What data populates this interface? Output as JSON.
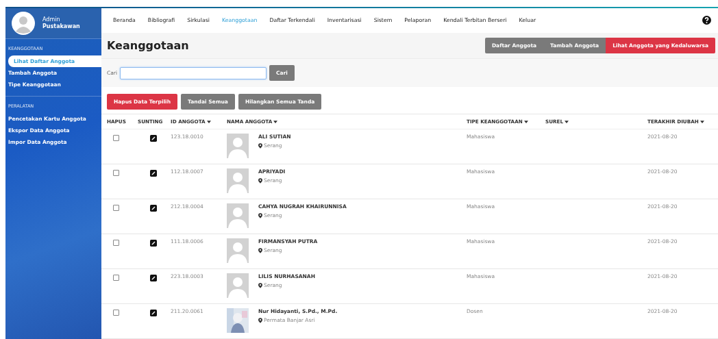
{
  "user": {
    "name": "Admin",
    "role": "Pustakawan"
  },
  "nav": [
    {
      "label": "Beranda",
      "selected": false
    },
    {
      "label": "Bibliografi",
      "selected": false
    },
    {
      "label": "Sirkulasi",
      "selected": false
    },
    {
      "label": "Keanggotaan",
      "selected": true
    },
    {
      "label": "Daftar Terkendali",
      "selected": false
    },
    {
      "label": "Inventarisasi",
      "selected": false
    },
    {
      "label": "Sistem",
      "selected": false
    },
    {
      "label": "Pelaporan",
      "selected": false
    },
    {
      "label": "Kendali Terbitan Berseri",
      "selected": false
    },
    {
      "label": "Keluar",
      "selected": false
    }
  ],
  "sidebar": [
    {
      "heading": "KEANGGOTAAN",
      "items": [
        {
          "label": "Lihat Daftar Anggota",
          "selected": true
        },
        {
          "label": "Tambah Anggota",
          "selected": false
        },
        {
          "label": "Tipe Keanggotaan",
          "selected": false
        }
      ]
    },
    {
      "heading": "PERALATAN",
      "items": [
        {
          "label": "Pencetakan Kartu Anggota",
          "selected": false
        },
        {
          "label": "Ekspor Data Anggota",
          "selected": false
        },
        {
          "label": "Impor Data Anggota",
          "selected": false
        }
      ]
    }
  ],
  "page_title": "Keanggotaan",
  "header_buttons": [
    {
      "label": "Daftar Anggota",
      "kind": "default"
    },
    {
      "label": "Tambah Anggota",
      "kind": "default"
    },
    {
      "label": "Lihat Anggota yang Kedaluwarsa",
      "kind": "danger"
    }
  ],
  "search": {
    "label": "Cari",
    "button": "Cari"
  },
  "actions": [
    {
      "label": "Hapus Data Terpilih",
      "kind": "danger"
    },
    {
      "label": "Tandai Semua",
      "kind": "default"
    },
    {
      "label": "Hilangkan Semua Tanda",
      "kind": "default"
    }
  ],
  "table": {
    "columns": [
      {
        "label": "HAPUS",
        "sortable": false
      },
      {
        "label": "SUNTING",
        "sortable": false
      },
      {
        "label": "ID ANGGOTA",
        "sortable": true
      },
      {
        "label": "NAMA ANGGOTA",
        "sortable": true
      },
      {
        "label": "TIPE KEANGGOTAAN",
        "sortable": true
      },
      {
        "label": "SUREL",
        "sortable": true
      },
      {
        "label": "TERAKHIR DIUBAH",
        "sortable": true
      }
    ],
    "rows": [
      {
        "checked": false,
        "id": "123.18.0010",
        "kind": "placeholder",
        "name": "ALI SUTIAN",
        "address": "Serang",
        "type": "Mahasiswa",
        "updated": "2021-08-20"
      },
      {
        "checked": false,
        "id": "112.18.0007",
        "kind": "placeholder",
        "name": "APRIYADI",
        "address": "Serang",
        "type": "Mahasiswa",
        "updated": "2021-08-20"
      },
      {
        "checked": false,
        "id": "212.18.0004",
        "kind": "placeholder",
        "name": "CAHYA NUGRAH KHAIRUNNISA",
        "address": "Serang",
        "type": "Mahasiswa",
        "updated": "2021-08-20"
      },
      {
        "checked": false,
        "id": "111.18.0006",
        "kind": "placeholder",
        "name": "FIRMANSYAH PUTRA",
        "address": "Serang",
        "type": "Mahasiswa",
        "updated": "2021-08-20"
      },
      {
        "checked": false,
        "id": "223.18.0003",
        "kind": "placeholder",
        "name": "LILIS NURHASANAH",
        "address": "Serang",
        "type": "Mahasiswa",
        "updated": "2021-08-20"
      },
      {
        "checked": false,
        "id": "211.20.0061",
        "kind": "picture",
        "name": "Nur Hidayanti, S.Pd., M.Pd.",
        "address": "Permata Banjar Asri",
        "type": "Dosen",
        "updated": "2021-08-20"
      }
    ]
  }
}
